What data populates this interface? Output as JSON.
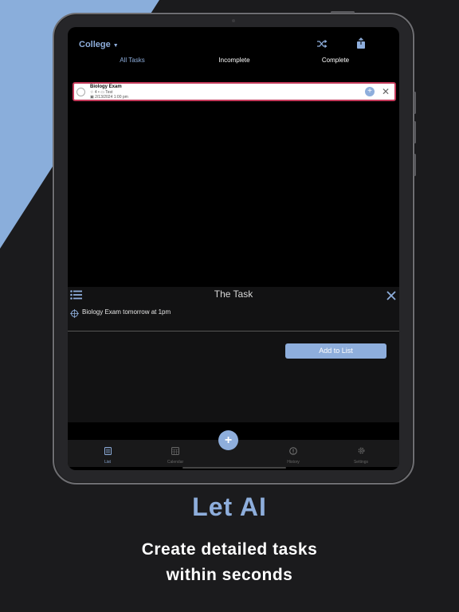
{
  "header": {
    "list_name": "College",
    "caret": "▼"
  },
  "tabs": [
    {
      "label": "All Tasks",
      "active": true
    },
    {
      "label": "Incomplete",
      "active": false
    },
    {
      "label": "Complete",
      "active": false
    }
  ],
  "task": {
    "name": "Biology Exam",
    "priority": "4",
    "category": "Test",
    "due": "2/13/2024 1:00 pm"
  },
  "sheet": {
    "title": "The Task",
    "prompt": "Biology Exam tomorrow at 1pm",
    "add_label": "Add to List"
  },
  "tabbar": [
    {
      "label": "List",
      "icon": "list-icon",
      "active": true
    },
    {
      "label": "Calendar",
      "icon": "calendar-icon",
      "active": false
    },
    {
      "label": "History",
      "icon": "history-icon",
      "active": false
    },
    {
      "label": "Settings",
      "icon": "settings-icon",
      "active": false
    }
  ],
  "fab_label": "+",
  "marketing": {
    "headline": "Let AI",
    "subline_1": "Create detailed tasks",
    "subline_2": "within seconds"
  },
  "colors": {
    "accent": "#8eaedc",
    "highlight": "#c33a5a",
    "background": "#1b1b1d",
    "stripe": "#8aaedb"
  }
}
